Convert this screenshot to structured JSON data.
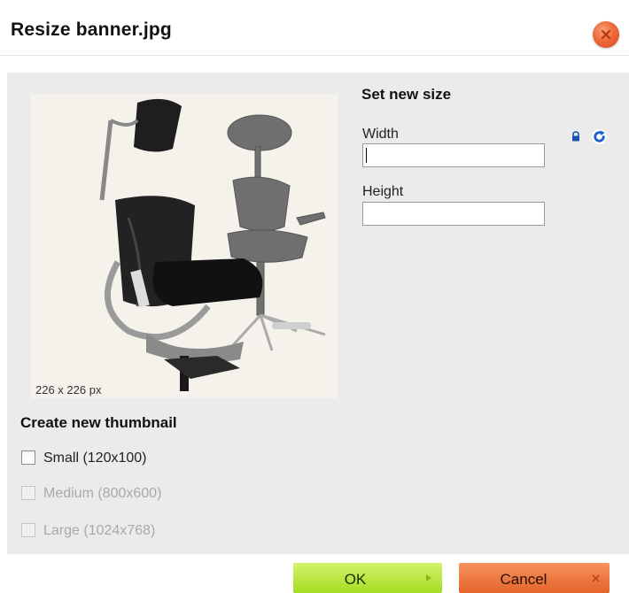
{
  "dialog": {
    "title": "Resize banner.jpg",
    "close_icon": "close-icon",
    "accent_close": "#ee6b3c"
  },
  "preview": {
    "image_subject": "office-chair-photo",
    "size_caption": "226 x 226 px"
  },
  "resize": {
    "heading": "Set new size",
    "width_label": "Width",
    "width_value": "",
    "height_label": "Height",
    "height_value": "",
    "lock_icon": "lock-icon",
    "reset_icon": "refresh-icon"
  },
  "thumbnail": {
    "heading": "Create new thumbnail",
    "options": [
      {
        "label": "Small (120x100)",
        "checked": false,
        "enabled": true
      },
      {
        "label": "Medium (800x600)",
        "checked": false,
        "enabled": false
      },
      {
        "label": "Large (1024x768)",
        "checked": false,
        "enabled": false
      }
    ]
  },
  "buttons": {
    "ok_label": "OK",
    "cancel_label": "Cancel",
    "ok_color": "#b4e43a",
    "cancel_color": "#ef7a42"
  }
}
